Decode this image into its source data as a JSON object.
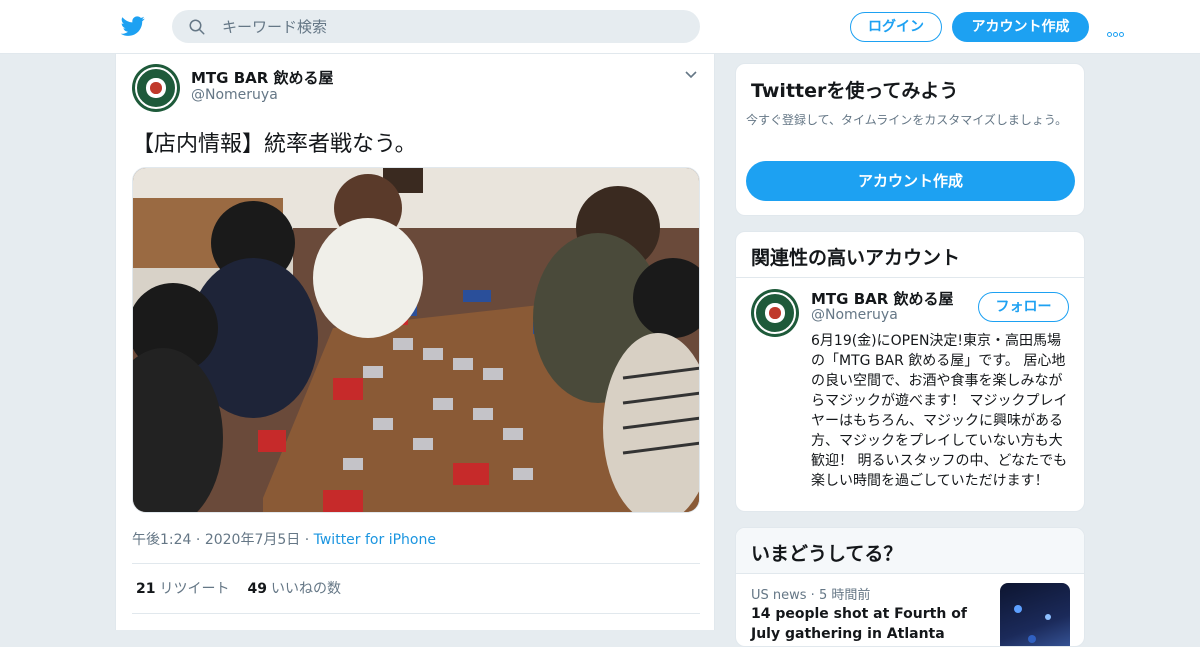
{
  "header": {
    "search_placeholder": "キーワード検索",
    "login_label": "ログイン",
    "signup_label": "アカウント作成"
  },
  "tweet": {
    "author_name": "MTG BAR 飲める屋",
    "author_handle": "@Nomeruya",
    "text": "【店内情報】統率者戦なう。",
    "time": "午後1:24",
    "date": "2020年7月5日",
    "source": "Twitter for iPhone",
    "retweet_count": "21",
    "retweet_label": "リツイート",
    "like_count": "49",
    "like_label": "いいねの数"
  },
  "signup_card": {
    "title": "Twitterを使ってみよう",
    "description": "今すぐ登録して、タイムラインをカスタマイズしましょう。",
    "button_label": "アカウント作成"
  },
  "related": {
    "title": "関連性の高いアカウント",
    "name": "MTG BAR 飲める屋",
    "handle": "@Nomeruya",
    "follow_label": "フォロー",
    "bio": "6月19(金)にOPEN決定!東京・高田馬場の「MTG BAR 飲める屋」です。 居心地の良い空間で、お酒や食事を楽しみながらマジックが遊べます！ マジックプレイヤーはもちろん、マジックに興味がある方、マジックをプレイしていない方も大歓迎！ 明るいスタッフの中、どなたでも楽しい時間を過ごしていただけます！"
  },
  "trends": {
    "title": "いまどうしてる？",
    "item_category": "US news",
    "item_time": "5 時間前",
    "item_headline": "14 people shot at Fourth of July gathering in Atlanta"
  },
  "colors": {
    "brand_blue": "#1da1f2",
    "link_blue": "#1b95e0",
    "background": "#e6ecf0"
  },
  "icons": [
    "twitter-bird-icon",
    "search-icon",
    "more-dots-icon",
    "chevron-down-icon"
  ]
}
